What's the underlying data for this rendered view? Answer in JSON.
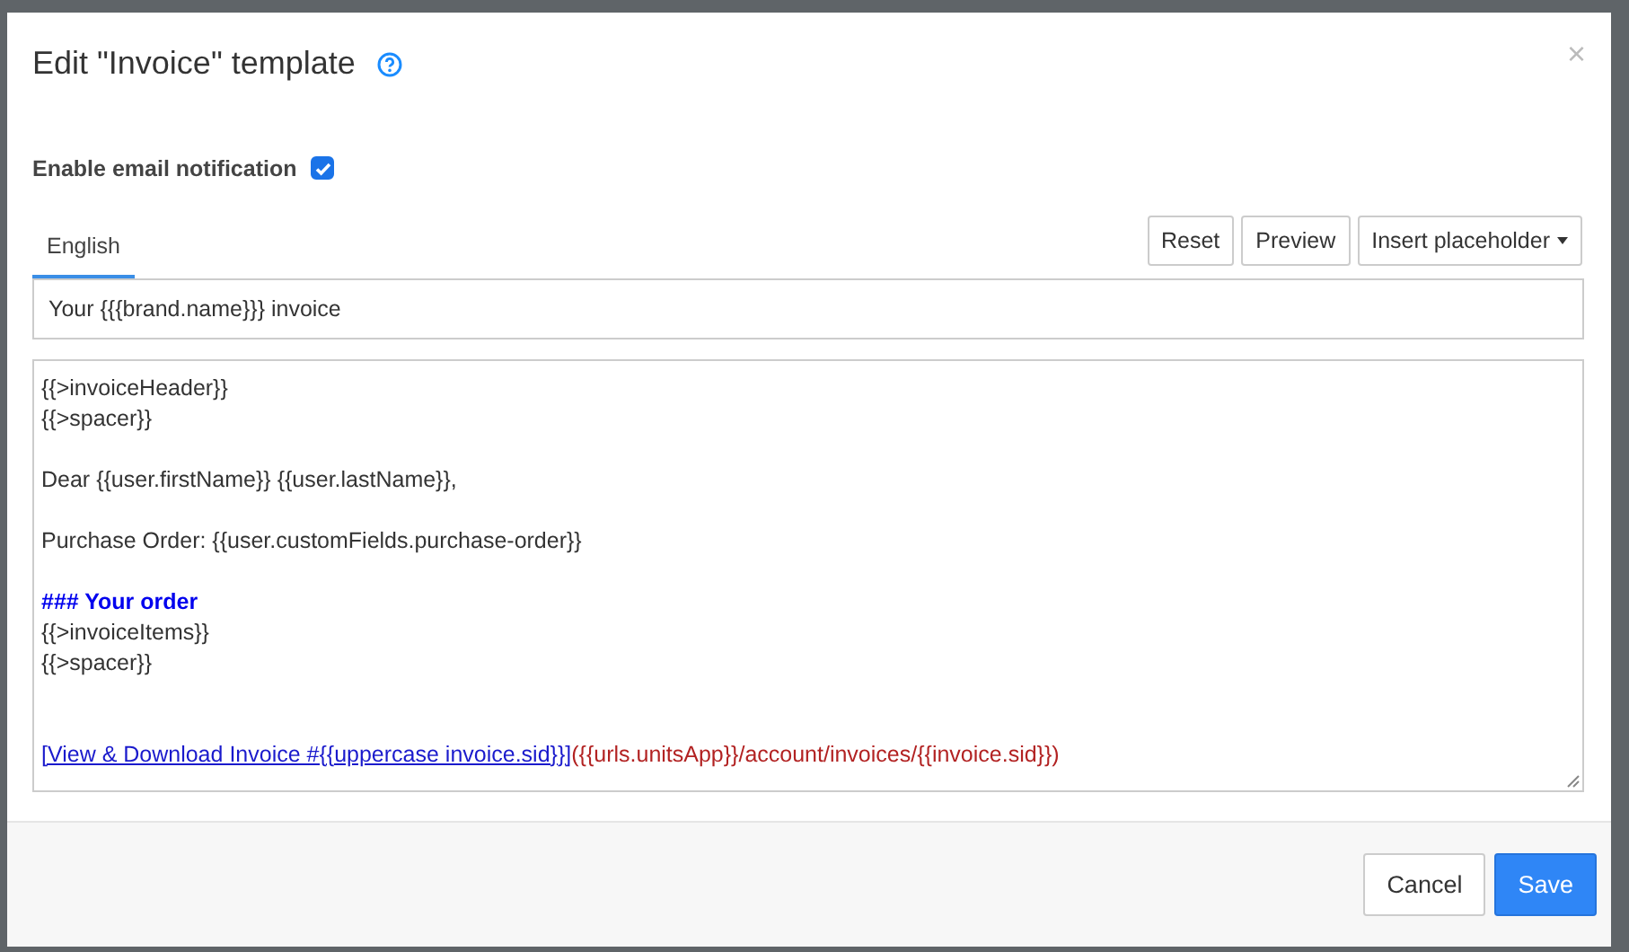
{
  "dialog": {
    "title": "Edit \"Invoice\" template",
    "close": "×"
  },
  "notification": {
    "label": "Enable email notification",
    "checked": true
  },
  "tabs": [
    {
      "label": "English",
      "selected": true
    }
  ],
  "toolbar": [
    {
      "label": "Reset",
      "kind": "plain"
    },
    {
      "label": "Preview",
      "kind": "plain"
    },
    {
      "label": "Insert placeholder",
      "kind": "dropdown"
    }
  ],
  "subject": {
    "value": "Your {{{brand.name}}} invoice"
  },
  "body": [
    {
      "kind": "text",
      "segments": [
        {
          "text": "{{>invoiceHeader}}",
          "kind": "plain"
        }
      ]
    },
    {
      "kind": "text",
      "segments": [
        {
          "text": "{{>spacer}}",
          "kind": "plain"
        }
      ]
    },
    {
      "kind": "gap"
    },
    {
      "kind": "text",
      "segments": [
        {
          "text": "Dear {{user.firstName}} {{user.lastName}},",
          "kind": "plain"
        }
      ]
    },
    {
      "kind": "gap"
    },
    {
      "kind": "text",
      "segments": [
        {
          "text": "Purchase Order: {{user.customFields.purchase-order}}",
          "kind": "plain"
        }
      ]
    },
    {
      "kind": "gap"
    },
    {
      "kind": "text",
      "segments": [
        {
          "text": "### Your order",
          "kind": "heading"
        }
      ]
    },
    {
      "kind": "text",
      "segments": [
        {
          "text": "{{>invoiceItems}}",
          "kind": "plain"
        }
      ]
    },
    {
      "kind": "text",
      "segments": [
        {
          "text": "{{>spacer}}",
          "kind": "plain"
        }
      ]
    },
    {
      "kind": "gap"
    },
    {
      "kind": "gap"
    },
    {
      "kind": "text",
      "segments": [
        {
          "text": "[View & Download Invoice #{{uppercase invoice.sid}}]",
          "kind": "link"
        },
        {
          "text": "({{urls.unitsApp}}/account/invoices/{{invoice.sid}})",
          "kind": "url"
        }
      ]
    }
  ],
  "footer": [
    {
      "label": "Cancel",
      "kind": "default"
    },
    {
      "label": "Save",
      "kind": "primary"
    }
  ]
}
